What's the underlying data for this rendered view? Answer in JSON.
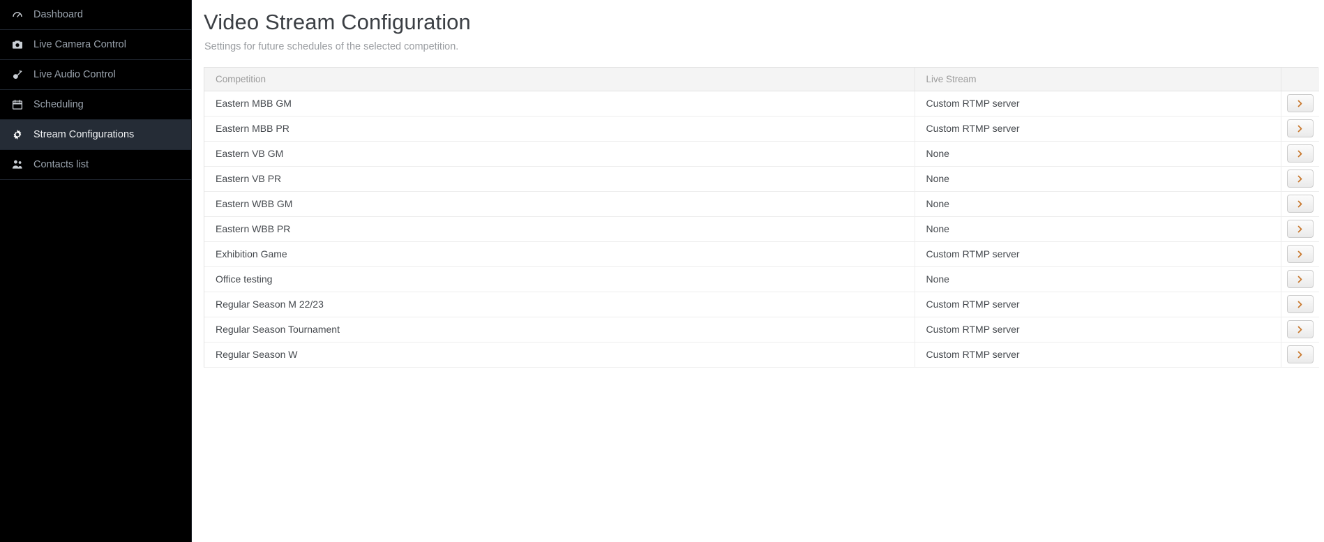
{
  "colors": {
    "sidebar_bg": "#000000",
    "sidebar_active_bg": "#252c36",
    "sidebar_text": "#9aa3ad",
    "page_title": "#3b3f44",
    "table_header_bg": "#f4f4f4",
    "chevron_accent": "#c8762a"
  },
  "sidebar": {
    "items": [
      {
        "label": "Dashboard",
        "icon": "gauge-icon",
        "active": false
      },
      {
        "label": "Live Camera Control",
        "icon": "camera-icon",
        "active": false
      },
      {
        "label": "Live Audio Control",
        "icon": "mic-icon",
        "active": false
      },
      {
        "label": "Scheduling",
        "icon": "calendar-icon",
        "active": false
      },
      {
        "label": "Stream Configurations",
        "icon": "gear-icon",
        "active": true
      },
      {
        "label": "Contacts list",
        "icon": "users-icon",
        "active": false
      }
    ]
  },
  "page": {
    "title": "Video Stream Configuration",
    "subtitle": "Settings for future schedules of the selected competition."
  },
  "table": {
    "columns": [
      "Competition",
      "Live Stream",
      ""
    ],
    "row_action_icon": "chevron-right-icon",
    "rows": [
      {
        "competition": "Eastern MBB GM",
        "live_stream": "Custom RTMP server"
      },
      {
        "competition": "Eastern MBB PR",
        "live_stream": "Custom RTMP server"
      },
      {
        "competition": "Eastern VB GM",
        "live_stream": "None"
      },
      {
        "competition": "Eastern VB PR",
        "live_stream": "None"
      },
      {
        "competition": "Eastern WBB GM",
        "live_stream": "None"
      },
      {
        "competition": "Eastern WBB PR",
        "live_stream": "None"
      },
      {
        "competition": "Exhibition Game",
        "live_stream": "Custom RTMP server"
      },
      {
        "competition": "Office testing",
        "live_stream": "None"
      },
      {
        "competition": "Regular Season M 22/23",
        "live_stream": "Custom RTMP server"
      },
      {
        "competition": "Regular Season Tournament",
        "live_stream": "Custom RTMP server"
      },
      {
        "competition": "Regular Season W",
        "live_stream": "Custom RTMP server"
      }
    ]
  }
}
